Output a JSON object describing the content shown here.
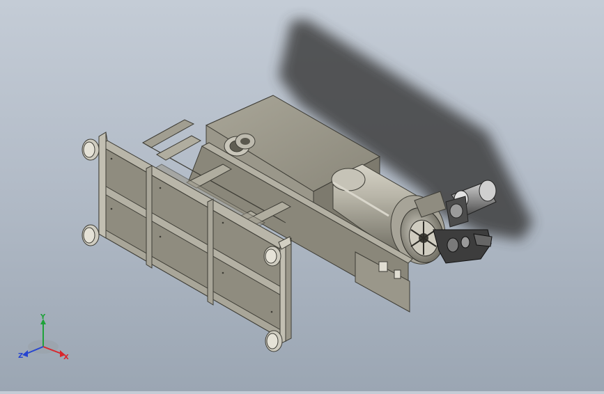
{
  "view": {
    "background_top": "#c4ccd6",
    "background_bottom": "#9ba6b3",
    "shadow_color": "#3c3c3c",
    "metal_color": "#8e8c7e",
    "metal_dark": "#5f5d52",
    "metal_light": "#b7b4a6"
  },
  "triad": {
    "x_label": "X",
    "y_label": "Y",
    "z_label": "Z",
    "x_color": "#d8262c",
    "y_color": "#1fa23a",
    "z_color": "#2745d0"
  }
}
